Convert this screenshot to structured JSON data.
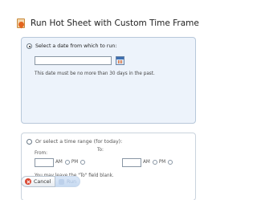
{
  "dialog": {
    "title": "Run Hot Sheet with Custom Time Frame",
    "title_icon": "hot-sheet-icon"
  },
  "date_option": {
    "label": "Select a date from which to run:",
    "selected": true,
    "date_value": "",
    "calendar_icon": "calendar-icon",
    "hint": "This date must be no more than 30 days in the past."
  },
  "range_option": {
    "label": "Or select a time range (for today):",
    "selected": false,
    "from_label": "From:",
    "to_label": "To:",
    "from_value": "",
    "to_value": "",
    "am_label": "AM",
    "pm_label": "PM",
    "hint": "You may leave the \"To\" field blank."
  },
  "buttons": {
    "cancel_label": "Cancel",
    "cancel_icon": "cancel-icon",
    "run_label": "Run",
    "run_enabled": false
  }
}
